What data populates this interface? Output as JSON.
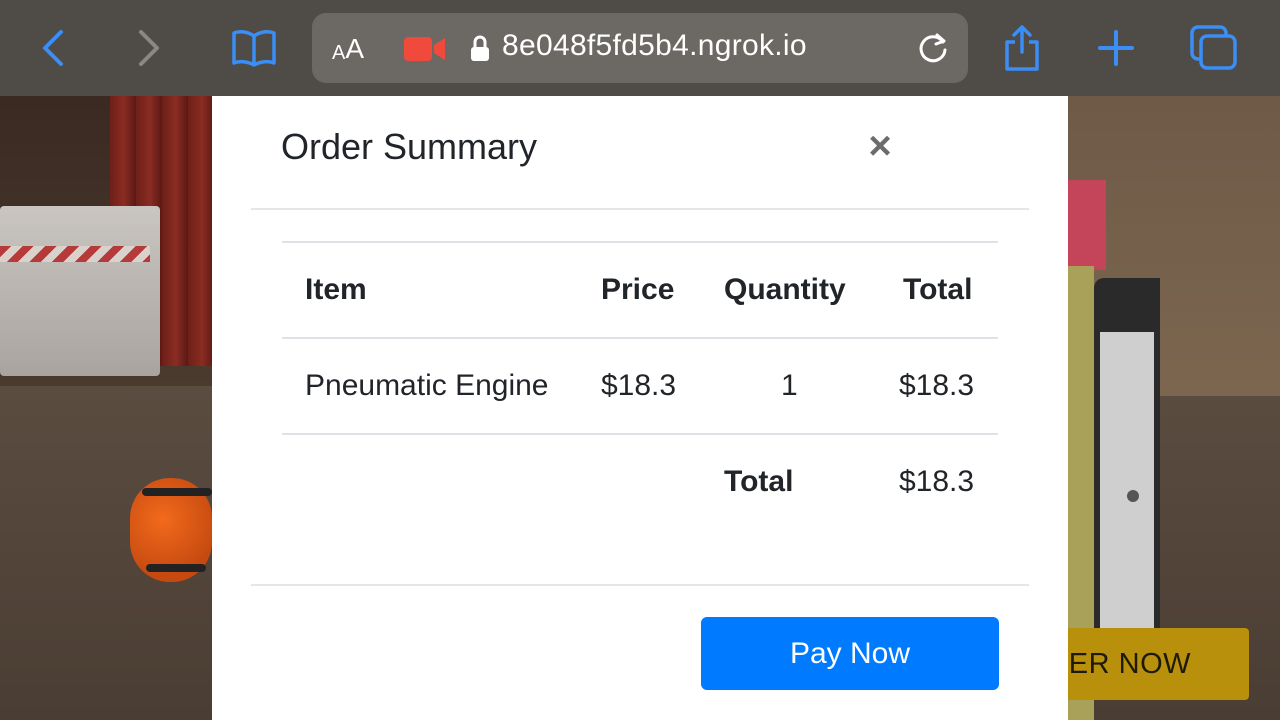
{
  "browser": {
    "back_icon": "chevron-left-icon",
    "forward_icon": "chevron-right-icon",
    "bookmarks_icon": "book-icon",
    "text_size_small": "A",
    "text_size_large": "A",
    "camera_icon": "video-camera-icon",
    "lock_icon": "lock-icon",
    "url": "8e048f5fd5b4.ngrok.io",
    "reload_icon": "reload-icon",
    "share_icon": "share-icon",
    "new_tab_icon": "plus-icon",
    "tabs_icon": "tabs-icon",
    "accent_color": "#3a8ef6"
  },
  "background": {
    "order_button_label": "ER NOW"
  },
  "modal": {
    "title": "Order Summary",
    "close_symbol": "×",
    "table": {
      "headers": [
        "Item",
        "Price",
        "Quantity",
        "Total"
      ],
      "rows": [
        {
          "item": "Pneumatic Engine",
          "price": "$18.3",
          "quantity": "1",
          "total": "$18.3"
        }
      ],
      "footer_label": "Total",
      "footer_value": "$18.3"
    },
    "pay_button_label": "Pay Now",
    "pay_button_color": "#007bff"
  }
}
